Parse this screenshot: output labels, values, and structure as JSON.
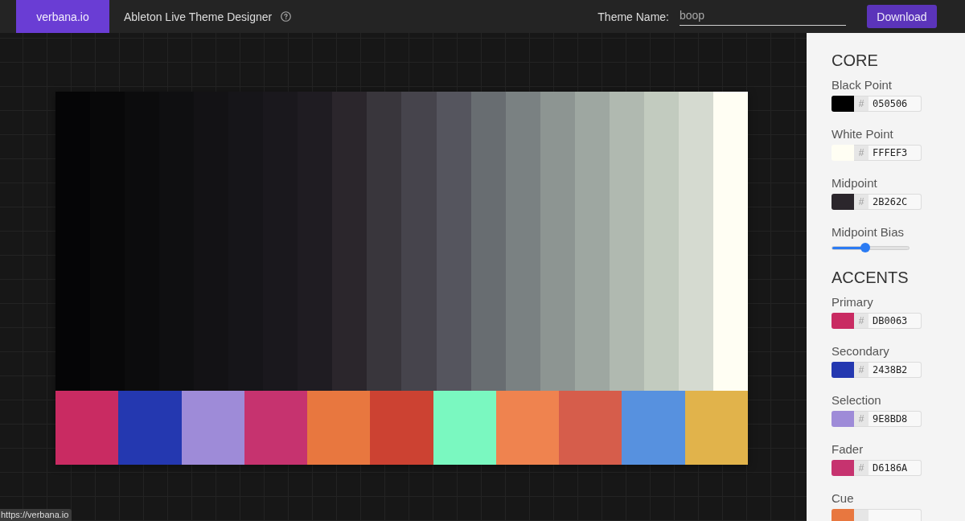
{
  "header": {
    "logo": "verbana.io",
    "title": "Ableton Live Theme Designer",
    "theme_name": {
      "label": "Theme Name:",
      "value": "boop"
    },
    "download_button": "Download"
  },
  "palette": {
    "shades": [
      {
        "color": "#050506"
      },
      {
        "color": "#080809"
      },
      {
        "color": "#0c0c0d"
      },
      {
        "color": "#0f0f11"
      },
      {
        "color": "#131215"
      },
      {
        "color": "#161519"
      },
      {
        "color": "#1a181d"
      },
      {
        "color": "#1f1c22"
      },
      {
        "color": "#2b262c"
      },
      {
        "color": "#39363c"
      },
      {
        "color": "#46444c"
      },
      {
        "color": "#55555e"
      },
      {
        "color": "#686d71"
      },
      {
        "color": "#7a8182"
      },
      {
        "color": "#8d9592"
      },
      {
        "color": "#9ea7a1"
      },
      {
        "color": "#b0b9b0"
      },
      {
        "color": "#c2cbbf"
      },
      {
        "color": "#d5dad0"
      },
      {
        "color": "#fffef3"
      }
    ],
    "accents": [
      {
        "color": "#c92b62"
      },
      {
        "color": "#2438b0"
      },
      {
        "color": "#9e8bd8"
      },
      {
        "color": "#c6336f"
      },
      {
        "color": "#e8773f"
      },
      {
        "color": "#cc4232"
      },
      {
        "color": "#7af8c0"
      },
      {
        "color": "#ef834f"
      },
      {
        "color": "#d65d4b"
      },
      {
        "color": "#5791df"
      },
      {
        "color": "#e1b34b"
      }
    ]
  },
  "sidebar": {
    "sections": [
      {
        "title": "CORE",
        "fields": [
          {
            "kind": "color",
            "label": "Black Point",
            "color": "#000000",
            "prefix": "#",
            "hex": "050506"
          },
          {
            "kind": "color",
            "label": "White Point",
            "color": "#fffef3",
            "prefix": "#",
            "hex": "FFFEF3"
          },
          {
            "kind": "color",
            "label": "Midpoint",
            "color": "#2b262c",
            "prefix": "#",
            "hex": "2B262C"
          },
          {
            "kind": "slider",
            "label": "Midpoint Bias",
            "level": 0.42
          }
        ]
      },
      {
        "title": "ACCENTS",
        "fields": [
          {
            "kind": "color",
            "label": "Primary",
            "color": "#c92b62",
            "prefix": "#",
            "hex": "DB0063"
          },
          {
            "kind": "color",
            "label": "Secondary",
            "color": "#2438b0",
            "prefix": "#",
            "hex": "2438B2"
          },
          {
            "kind": "color",
            "label": "Selection",
            "color": "#9e8bd8",
            "prefix": "#",
            "hex": "9E8BD8"
          },
          {
            "kind": "color",
            "label": "Fader",
            "color": "#c6336f",
            "prefix": "#",
            "hex": "D6186A"
          },
          {
            "kind": "color",
            "label": "Cue",
            "color": "#e8773f"
          }
        ]
      }
    ]
  },
  "status_bar": {
    "url": "https://verbana.io"
  }
}
